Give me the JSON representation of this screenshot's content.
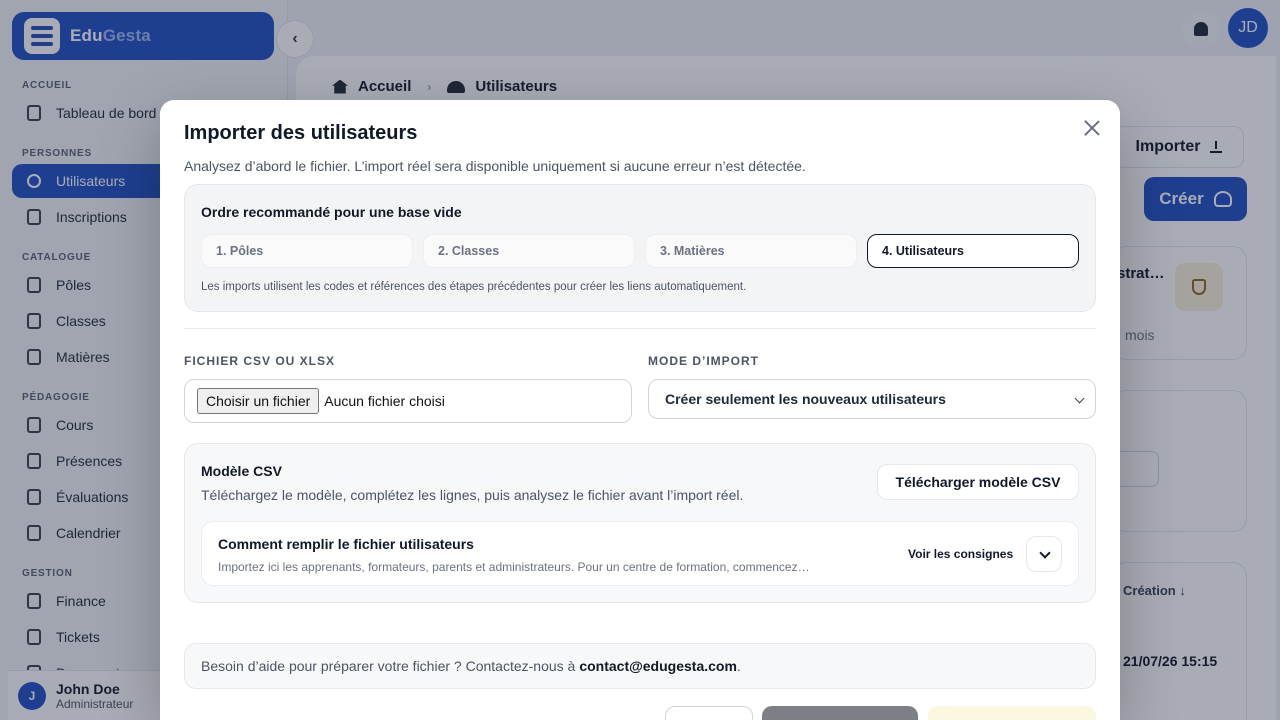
{
  "brand": {
    "prefix": "Edu",
    "suffix": "Gesta"
  },
  "sidebar": {
    "sections": [
      {
        "label": "ACCUEIL",
        "items": [
          {
            "label": "Tableau de bord",
            "active": false
          }
        ]
      },
      {
        "label": "PERSONNES",
        "items": [
          {
            "label": "Utilisateurs",
            "active": true
          },
          {
            "label": "Inscriptions",
            "active": false
          }
        ]
      },
      {
        "label": "CATALOGUE",
        "items": [
          {
            "label": "Pôles",
            "active": false
          },
          {
            "label": "Classes",
            "active": false
          },
          {
            "label": "Matières",
            "active": false
          }
        ]
      },
      {
        "label": "PÉDAGOGIE",
        "items": [
          {
            "label": "Cours",
            "active": false
          },
          {
            "label": "Présences",
            "active": false
          },
          {
            "label": "Évaluations",
            "active": false
          },
          {
            "label": "Calendrier",
            "active": false
          }
        ]
      },
      {
        "label": "GESTION",
        "items": [
          {
            "label": "Finance",
            "active": false
          },
          {
            "label": "Tickets",
            "active": false
          },
          {
            "label": "Documents",
            "active": false
          }
        ]
      }
    ],
    "user": {
      "initial": "J",
      "name": "John Doe",
      "role": "Administrateur"
    }
  },
  "topbar": {
    "avatar_initials": "JD",
    "icons": [
      "bell-icon"
    ]
  },
  "main": {
    "breadcrumb": {
      "home": "Accueil",
      "current": "Utilisateurs"
    },
    "import_label": "Importer",
    "create_label": "Créer",
    "partial_card_title": "strat…",
    "partial_card_sub": "mois",
    "table_header": "Création",
    "table_cell": "21/07/26 15:15"
  },
  "modal": {
    "title": "Importer des utilisateurs",
    "subtitle": "Analysez d’abord le fichier. L’import réel sera disponible uniquement si aucune erreur n’est détectée.",
    "order": {
      "title": "Ordre recommandé pour une base vide",
      "steps": [
        "1. Pôles",
        "2. Classes",
        "3. Matières",
        "4. Utilisateurs"
      ],
      "active_step": 3,
      "note": "Les imports utilisent les codes et références des étapes précédentes pour créer les liens automatiquement."
    },
    "file_label": "FICHIER CSV OU XLSX",
    "file_button": "Choisir un fichier",
    "file_status": "Aucun fichier choisi",
    "mode_label": "MODE D’IMPORT",
    "mode_value": "Créer seulement les nouveaux utilisateurs",
    "csv": {
      "title": "Modèle CSV",
      "description": "Téléchargez le modèle, complétez les lignes, puis analysez le fichier avant l’import réel.",
      "download_label": "Télécharger modèle CSV",
      "guide_title": "Comment remplir le fichier utilisateurs",
      "guide_desc": "Importez ici les apprenants, formateurs, parents et administrateurs. Pour un centre de formation, commencez…",
      "guide_toggle_label": "Voir les consignes"
    },
    "help": {
      "text": "Besoin d’aide pour préparer votre fichier ? Contactez-nous à",
      "email": "contact@edugesta.com",
      "suffix": "."
    }
  }
}
